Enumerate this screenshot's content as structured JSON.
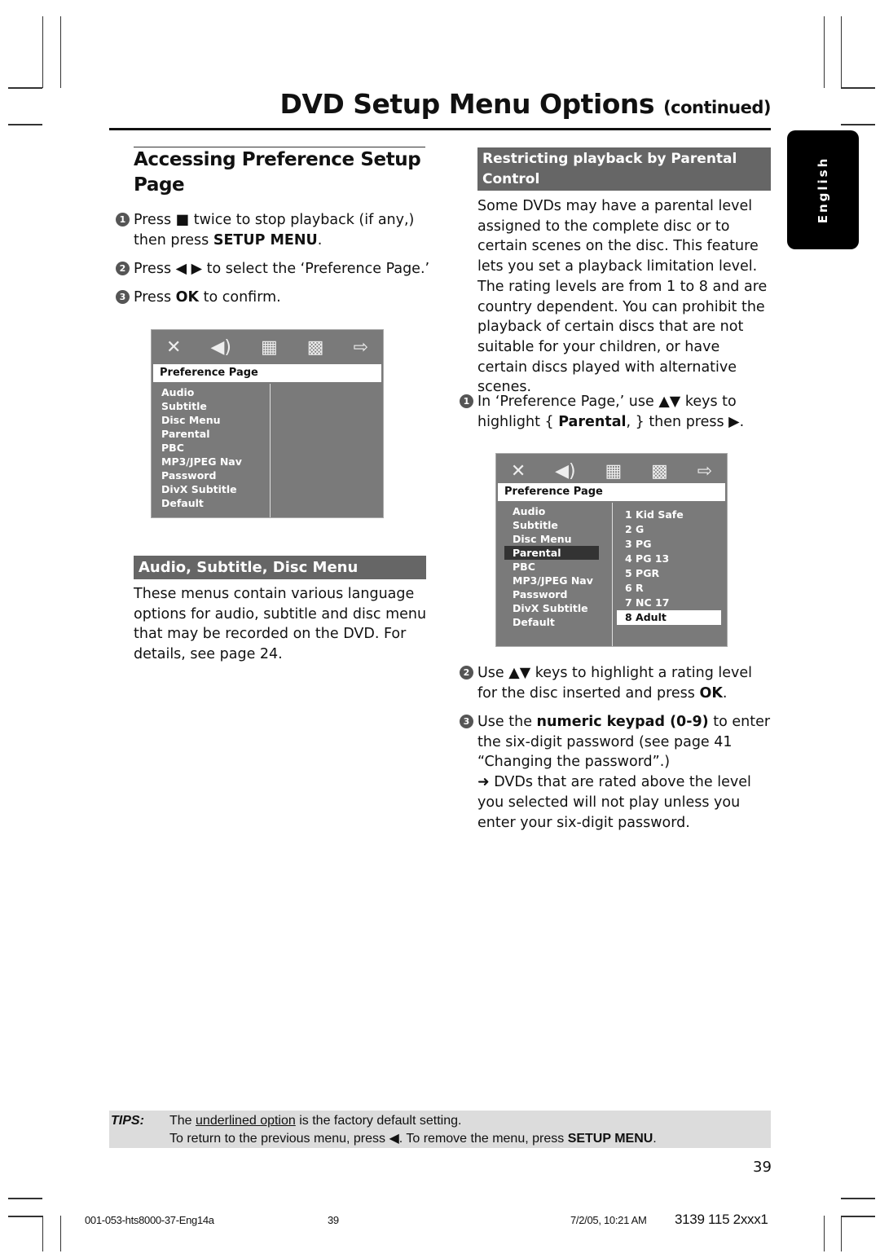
{
  "header": {
    "title": "DVD Setup Menu Options",
    "title_suffix": "(continued)"
  },
  "language_tab": "English",
  "left": {
    "section_title": "Accessing Preference Setup Page",
    "steps": [
      {
        "num": "1",
        "pre": "Press ",
        "icon": "■",
        "post": " twice to stop playback (if any,) then press ",
        "bold": "SETUP MENU",
        "end": "."
      },
      {
        "num": "2",
        "pre": "Press ",
        "icon": "◀ ▶",
        "post": " to select the ‘Preference Page.’"
      },
      {
        "num": "3",
        "pre": "Press ",
        "bold": "OK",
        "post": " to confirm."
      }
    ],
    "osd": {
      "icons": [
        "tools-icon",
        "speaker-icon",
        "video-icon",
        "checklist-icon",
        "exit-icon"
      ],
      "page_label": "Preference Page",
      "items": [
        "Audio",
        "Subtitle",
        "Disc Menu",
        "Parental",
        "PBC",
        "MP3/JPEG Nav",
        "Password",
        "DivX Subtitle",
        "Default"
      ]
    },
    "subsection_title": "Audio, Subtitle, Disc Menu",
    "subsection_body": "These menus contain various language options for audio, subtitle and disc menu that may be recorded on the DVD.  For details, see page 24."
  },
  "right": {
    "section_title": "Restricting playback by Parental Control",
    "intro": "Some DVDs may have a parental level assigned to the complete disc or to certain scenes on the disc.  This feature lets you set a playback limitation level. The rating levels are from 1 to 8 and are country dependent. You can prohibit the playback of certain discs that are not suitable for your children, or have certain discs played with alternative scenes.",
    "step1": {
      "num": "1",
      "pre": "In ‘Preference Page,’ use ▲▼ keys to highlight { ",
      "bold": "Parental",
      "post": ", } then press ▶."
    },
    "osd": {
      "page_label": "Preference Page",
      "items": [
        "Audio",
        "Subtitle",
        "Disc Menu",
        "Parental",
        "PBC",
        "MP3/JPEG Nav",
        "Password",
        "DivX Subtitle",
        "Default"
      ],
      "selected_item": "Parental",
      "ratings": [
        "1  Kid Safe",
        "2  G",
        "3  PG",
        "4  PG 13",
        "5  PGR",
        "6  R",
        "7  NC 17",
        "8  Adult"
      ],
      "selected_rating": "8  Adult"
    },
    "step2": {
      "num": "2",
      "pre": "Use ▲▼ keys to highlight a rating level for the disc inserted and press ",
      "bold": "OK",
      "post": "."
    },
    "step3": {
      "num": "3",
      "pre": "Use the ",
      "bold": "numeric keypad (0-9)",
      "post": " to enter the six-digit password (see page 41 “Changing the password”.)",
      "result": "➜ DVDs that are rated above the level you selected will not play unless you enter your six-digit password."
    }
  },
  "tips": {
    "label": "TIPS:",
    "line1_pre": "The ",
    "line1_underlined": "underlined option",
    "line1_post": " is the factory default setting.",
    "line2_pre": "To return to the previous menu, press ◀.  To remove the menu, press ",
    "line2_bold": "SETUP MENU",
    "line2_end": "."
  },
  "page_number": "39",
  "footer": {
    "file": "001-053-hts8000-37-Eng14a",
    "page": "39",
    "date": "7/2/05, 10:21 AM",
    "code": "3139 115 2xxx1"
  }
}
